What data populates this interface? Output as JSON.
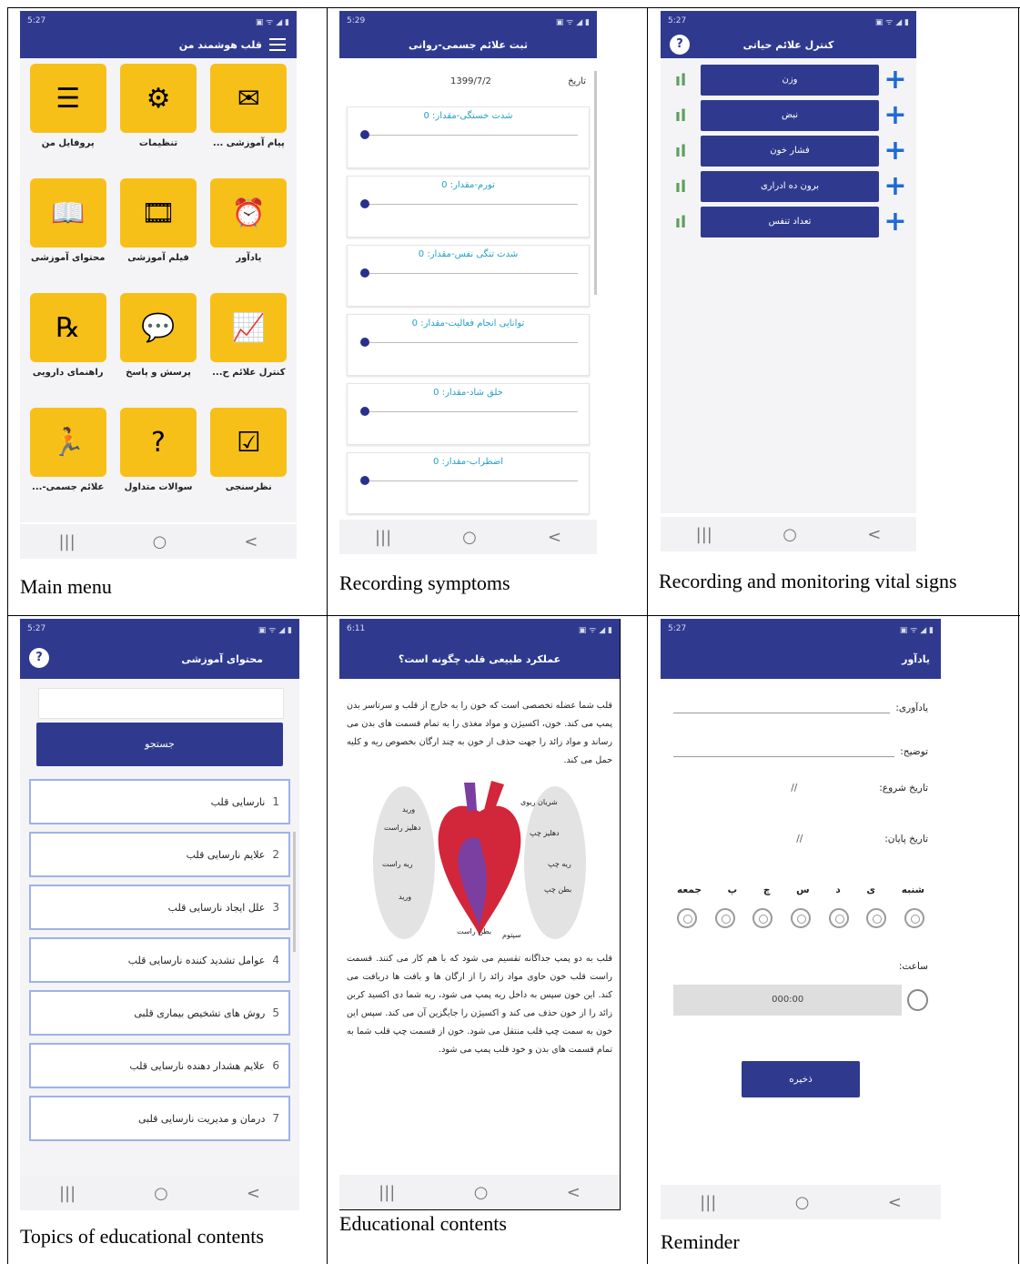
{
  "captions": {
    "p1": "Main menu",
    "p2": "Recording symptoms",
    "p3": "Recording and monitoring vital signs",
    "p4": "Topics of educational contents",
    "p5": "Educational contents",
    "p6": "Reminder"
  },
  "status": {
    "p1_time": "5:27",
    "p2_time": "5:29",
    "p3_time": "5:27",
    "p4_time": "5:27",
    "p5_time": "6:11",
    "p6_time": "5:27",
    "right_icons": "▣ ᯤ ◢ ▮"
  },
  "nav": {
    "recents": "|||",
    "home": "○",
    "back": "<"
  },
  "main_menu": {
    "title": "قلب هوشمند من",
    "items": [
      {
        "label": "پیام آموزشی ...",
        "icon": "✉"
      },
      {
        "label": "تنظیمات",
        "icon": "⚙"
      },
      {
        "label": "پروفایل من",
        "icon": "☰"
      },
      {
        "label": "یادآور",
        "icon": "⏰"
      },
      {
        "label": "فیلم آموزشی",
        "icon": "🎞"
      },
      {
        "label": "محتوای آموزشی",
        "icon": "📖"
      },
      {
        "label": "کنترل علائم ح...",
        "icon": "📈"
      },
      {
        "label": "پرسش و پاسخ",
        "icon": "💬"
      },
      {
        "label": "راهنمای دارویی",
        "icon": "℞"
      },
      {
        "label": "نظرسنجی",
        "icon": "☑"
      },
      {
        "label": "سوالات متداول",
        "icon": "?"
      },
      {
        "label": "علائم جسمی-...",
        "icon": "🏃"
      }
    ]
  },
  "symptoms": {
    "title": "ثبت علائم جسمی-روانی",
    "date_label": "تاریخ",
    "date_value": "1399/7/2",
    "items": [
      "شدت خستگی-مقدار: 0",
      "تورم-مقدار: 0",
      "شدت تنگی نفس-مقدار: 0",
      "توانایی انجام فعالیت-مقدار: 0",
      "خلق شاد-مقدار: 0",
      "اضطراب-مقدار: 0"
    ]
  },
  "vitals": {
    "title": "کنترل علائم حیاتی",
    "help": "?",
    "items": [
      "وزن",
      "نبض",
      "فشار خون",
      "برون ده ادراری",
      "تعداد تنفس"
    ],
    "plus": "+",
    "chart_icon": "ıl",
    "icon_color": "#5aa05a",
    "plus_color": "#1f6bd6"
  },
  "topics": {
    "title": "محتوای آموزشی",
    "help": "?",
    "search_placeholder": "",
    "search_label": "جستجو",
    "items": [
      {
        "n": "1",
        "text": "نارسایی قلب"
      },
      {
        "n": "2",
        "text": "علایم نارسایی قلب"
      },
      {
        "n": "3",
        "text": "علل ایجاد نارسایی قلب"
      },
      {
        "n": "4",
        "text": "عوامل تشدید کننده نارسایی قلب"
      },
      {
        "n": "5",
        "text": "روش های تشخیص بیماری قلبی"
      },
      {
        "n": "6",
        "text": "علایم هشدار دهنده نارسایی قلب"
      },
      {
        "n": "7",
        "text": "درمان و مدیریت نارسایی قلبی"
      }
    ]
  },
  "article": {
    "title": "عملکرد طبیعی قلب چگونه است؟",
    "para1": "قلب شما عضله تخصصی است که خون را به خارج از قلب و سرتاسر بدن پمپ می کند. خون، اکسیژن و مواد مغذی را به تمام قسمت های بدن می رساند و مواد زائد را جهت حذف از خون به چند ارگان بخصوص ریه و کلیه حمل می کند.",
    "para2": "قلب به دو پمپ جداگانه تقسیم می شود که با هم کار می کنند. قسمت راست قلب خون حاوی مواد زائد را از ارگان ها و بافت ها دریافت می کند. این خون سپس به داخل ریه پمپ می شود، ریه شما دی اکسید کربن زائد را از خون حذف می کند و اکسیژن را جایگزین آن می کند. سپس این خون به سمت چپ قلب منتقل می شود. خون از قسمت چپ قلب شما به تمام قسمت های بدن و خود قلب پمپ می شود.",
    "diagram_labels": [
      "ورید",
      "دهلیز راست",
      "ریه راست",
      "ورید",
      "بطن راست",
      "سپتوم",
      "بطن چپ",
      "ریه چپ",
      "دهلیز چپ",
      "شریان ریوی"
    ]
  },
  "reminder": {
    "title": "یادآور",
    "reminder_label": "یادآوری:",
    "desc_label": "توضیح:",
    "start_label": "تاریخ شروع:",
    "start_value": "//",
    "end_label": "تاریخ پایان:",
    "end_value": "//",
    "days": [
      "شنبه",
      "ی",
      "د",
      "س",
      "چ",
      "پ",
      "جمعه"
    ],
    "time_label": "ساعت:",
    "time_value": "000:00",
    "save_label": "ذخیره"
  }
}
